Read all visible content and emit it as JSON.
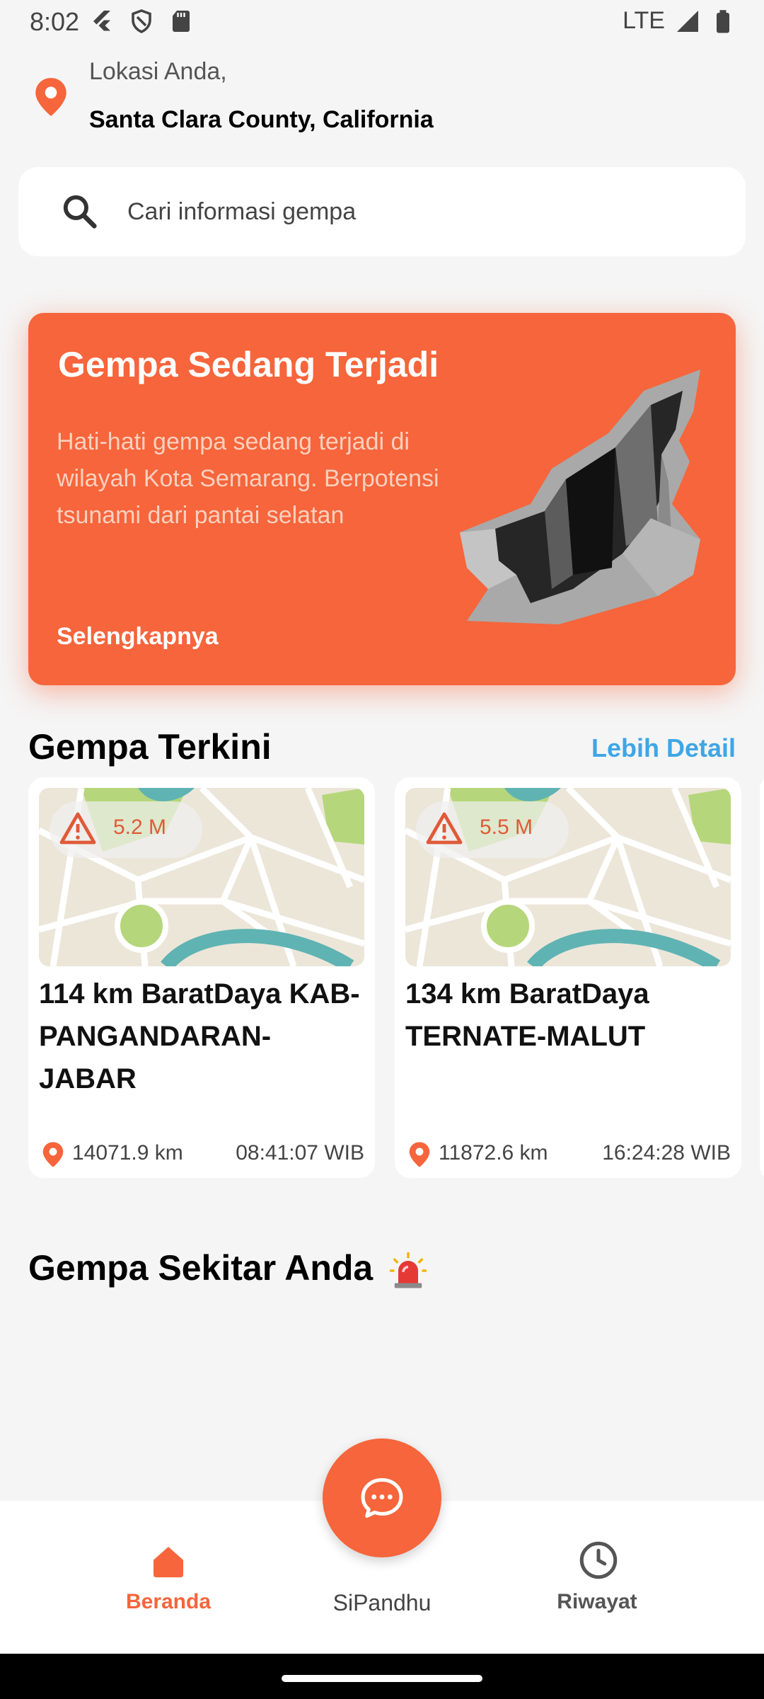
{
  "status_bar": {
    "time": "8:02",
    "network": "LTE"
  },
  "location": {
    "label": "Lokasi Anda,",
    "value": "Santa Clara County, California"
  },
  "search": {
    "placeholder": "Cari informasi gempa"
  },
  "alert": {
    "title": "Gempa Sedang Terjadi",
    "body": "Hati-hati gempa sedang terjadi di wilayah Kota Semarang. Berpotensi tsunami dari pantai selatan",
    "more_label": "Selengkapnya"
  },
  "recent": {
    "title": "Gempa Terkini",
    "more_label": "Lebih Detail",
    "cards": [
      {
        "magnitude": "5.2 M",
        "title": "114 km BaratDaya KAB-PANGANDARAN-JABAR",
        "distance": "14071.9 km",
        "time": "08:41:07 WIB"
      },
      {
        "magnitude": "5.5 M",
        "title": "134 km BaratDaya TERNATE-MALUT",
        "distance": "11872.6 km",
        "time": "16:24:28 WIB"
      }
    ]
  },
  "nearby": {
    "title": "Gempa Sekitar Anda"
  },
  "bottom_nav": {
    "items": [
      {
        "label": "Beranda",
        "icon": "home-icon",
        "active": true
      },
      {
        "label": "SiPandhu",
        "icon": "chat-icon",
        "active": false
      },
      {
        "label": "Riwayat",
        "icon": "clock-icon",
        "active": false
      }
    ]
  },
  "colors": {
    "accent": "#f6653b",
    "link": "#3ea6e6",
    "background": "#f5f5f5"
  }
}
